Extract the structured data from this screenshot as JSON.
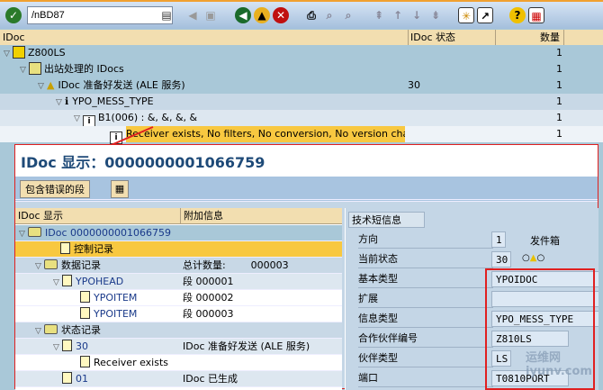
{
  "toolbar": {
    "command": "/nBD87",
    "icons": [
      "enter-icon",
      "back-icon",
      "exit-icon",
      "cancel-icon",
      "print-icon",
      "find-icon",
      "find-next-icon",
      "first-page-icon",
      "prev-page-icon",
      "next-page-icon",
      "last-page-icon",
      "new-session-icon",
      "shortcut-icon",
      "help-icon",
      "layout-icon"
    ]
  },
  "top_tree": {
    "headers": {
      "idoc": "IDoc",
      "status": "IDoc 状态",
      "count": "数量"
    },
    "rows": [
      {
        "label": "Z800LS",
        "status": "",
        "count": "1"
      },
      {
        "label": "出站处理的 IDocs",
        "status": "",
        "count": "1"
      },
      {
        "label": "IDoc 准备好发送 (ALE 服务)",
        "status": "30",
        "count": "1"
      },
      {
        "label": "YPO_MESS_TYPE",
        "status": "",
        "count": "1"
      },
      {
        "label": "B1(006) : &, &, &, &",
        "status": "",
        "count": "1"
      },
      {
        "label": "Receiver exists, No filters, No conversion, No version cha",
        "status": "",
        "count": "1"
      }
    ]
  },
  "display": {
    "title_prefix": "IDoc 显示：",
    "idoc_number": "0000000001066759",
    "error_segments_button": "包含错误的段",
    "tree_headers": {
      "idoc": "IDoc 显示",
      "info": "附加信息"
    },
    "tree": [
      {
        "label": "IDoc 0000000001066759",
        "info": ""
      },
      {
        "label": "控制记录",
        "info": ""
      },
      {
        "label": "数据记录",
        "info": "总计数量:        000003"
      },
      {
        "label": "YPOHEAD",
        "info": "段 000001"
      },
      {
        "label": "YPOITEM",
        "info": "段 000002"
      },
      {
        "label": "YPOITEM",
        "info": "段 000003"
      },
      {
        "label": "状态记录",
        "info": ""
      },
      {
        "label": "30",
        "info": "IDoc 准备好发送 (ALE 服务)"
      },
      {
        "label": "Receiver exists",
        "info": ""
      },
      {
        "label": "01",
        "info": "IDoc 已生成"
      }
    ],
    "tech": {
      "tab": "技术短信息",
      "direction_label": "方向",
      "direction": "1",
      "direction_text": "发件箱",
      "status_label": "当前状态",
      "status": "30",
      "basic_type_label": "基本类型",
      "basic_type": "YPOIDOC",
      "extension_label": "扩展",
      "extension": "",
      "message_type_label": "信息类型",
      "message_type": "YPO_MESS_TYPE",
      "partner_no_label": "合作伙伴编号",
      "partner_no": "Z810LS",
      "partner_type_label": "伙伴类型",
      "partner_type": "LS",
      "port_label": "端口",
      "port": "T0810PORT"
    }
  },
  "watermark": "运维网 iyunv.com"
}
